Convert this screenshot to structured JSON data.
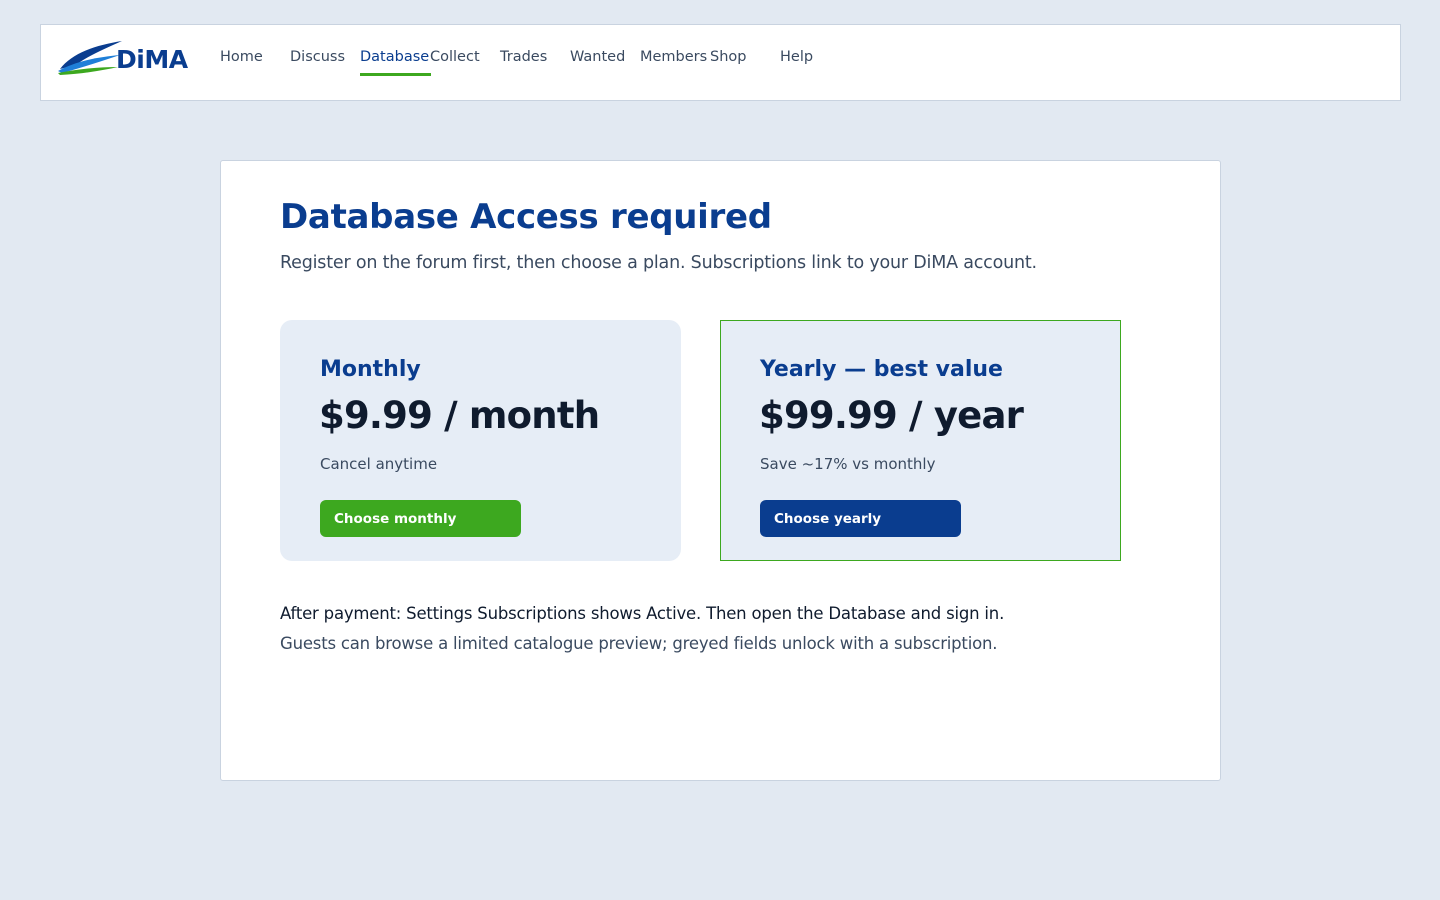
{
  "brand": {
    "name": "DiMA",
    "colors": {
      "primary": "#0a3d8f",
      "accent": "#3da81f",
      "page_bg": "#e2e9f2"
    }
  },
  "nav": {
    "items": [
      {
        "label": "Home",
        "active": false
      },
      {
        "label": "Discuss",
        "active": false
      },
      {
        "label": "Database",
        "active": true
      },
      {
        "label": "Collect",
        "active": false
      },
      {
        "label": "Trades",
        "active": false
      },
      {
        "label": "Wanted",
        "active": false
      },
      {
        "label": "Members",
        "active": false
      },
      {
        "label": "Shop",
        "active": false
      },
      {
        "label": "Help",
        "active": false
      }
    ]
  },
  "main": {
    "title": "Database Access required",
    "subtitle": "Register on the forum first, then choose a plan. Subscriptions link to your DiMA account.",
    "plans": [
      {
        "name": "Monthly",
        "price": "$9.99 / month",
        "note": "Cancel anytime",
        "button": "Choose monthly",
        "button_color": "#3da81f"
      },
      {
        "name": "Yearly — best value",
        "price": "$99.99 / year",
        "note": "Save ~17% vs monthly",
        "button": "Choose yearly",
        "button_color": "#0a3d8f"
      }
    ],
    "after_payment": "After payment: Settings  Subscriptions shows Active. Then open the Database and sign in.",
    "guests_note": "Guests can browse a limited catalogue preview; greyed fields unlock with a subscription."
  }
}
